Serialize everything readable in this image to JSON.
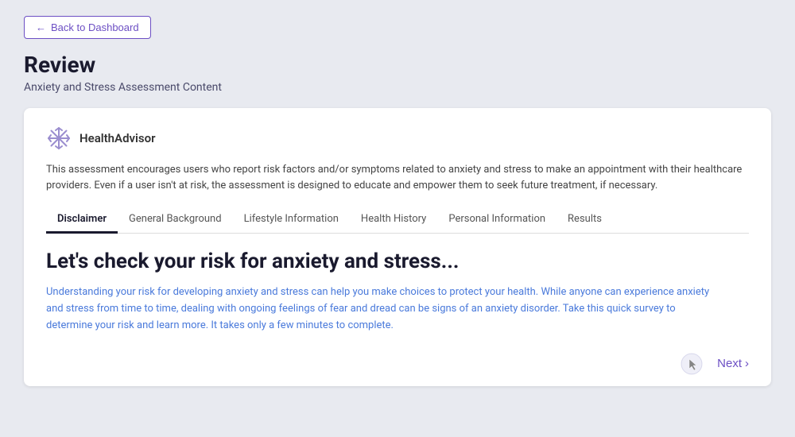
{
  "back_button": {
    "label": "Back to Dashboard",
    "arrow": "←"
  },
  "page": {
    "title": "Review",
    "subtitle": "Anxiety and Stress Assessment Content"
  },
  "card": {
    "brand_name": "HealthAdvisor",
    "description": "This assessment encourages users who report risk factors and/or symptoms related to anxiety and stress to make an appointment with their healthcare providers. Even if a user isn't at risk, the assessment is designed to educate and empower them to seek future treatment, if necessary.",
    "tabs": [
      {
        "label": "Disclaimer",
        "active": true
      },
      {
        "label": "General Background",
        "active": false
      },
      {
        "label": "Lifestyle Information",
        "active": false
      },
      {
        "label": "Health History",
        "active": false
      },
      {
        "label": "Personal Information",
        "active": false
      },
      {
        "label": "Results",
        "active": false
      }
    ],
    "content_heading": "Let's check your risk for anxiety and stress...",
    "content_body": "Understanding your risk for developing anxiety and stress can help you make choices to protect your health. While anyone can experience anxiety and stress from time to time, dealing with ongoing feelings of fear and dread can be signs of an anxiety disorder. Take this quick survey to determine your risk and learn more. It takes only a few minutes to complete.",
    "next_label": "Next",
    "next_arrow": "›"
  }
}
